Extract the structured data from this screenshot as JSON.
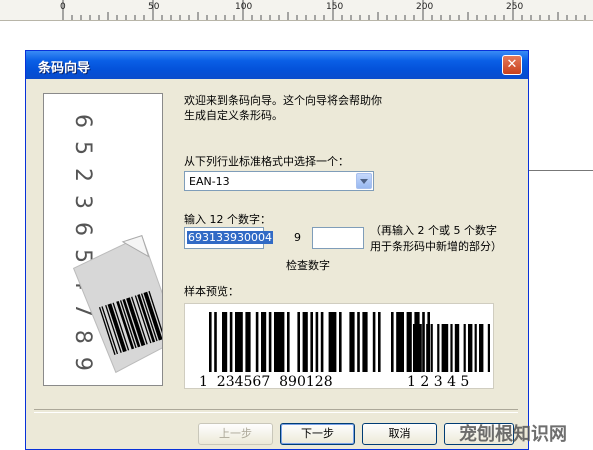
{
  "ruler": {
    "labels": [
      "0",
      "50",
      "100",
      "150",
      "200",
      "250"
    ]
  },
  "dialog": {
    "title": "条码向导",
    "close_glyph": "✕",
    "welcome_line1": "欢迎来到条码向导。这个向导将会帮助你",
    "welcome_line2": "生成自定义条形码。",
    "select_label": "从下列行业标准格式中选择一个：",
    "select_value": "EAN-13",
    "digits_label": "输入 12 个数字：",
    "digits_value": "693133930004",
    "check_digit": "9",
    "addon_value": "",
    "addon_hint_line1": "（再输入 2 个或 5 个数字",
    "addon_hint_line2": "用于条形码中新增的部分）",
    "check_label": "检查数字",
    "preview_label": "样本预览：",
    "preview_main_digits": "1  234567  890128",
    "preview_addon_digits": "1 2 3 4 5",
    "illus_digits": "6 5 2 3 6 5 4 7 8 9 6 9",
    "buttons": {
      "prev": "上一步",
      "next": "下一步",
      "cancel": "取消"
    }
  },
  "watermark": "宠刨根知识网"
}
